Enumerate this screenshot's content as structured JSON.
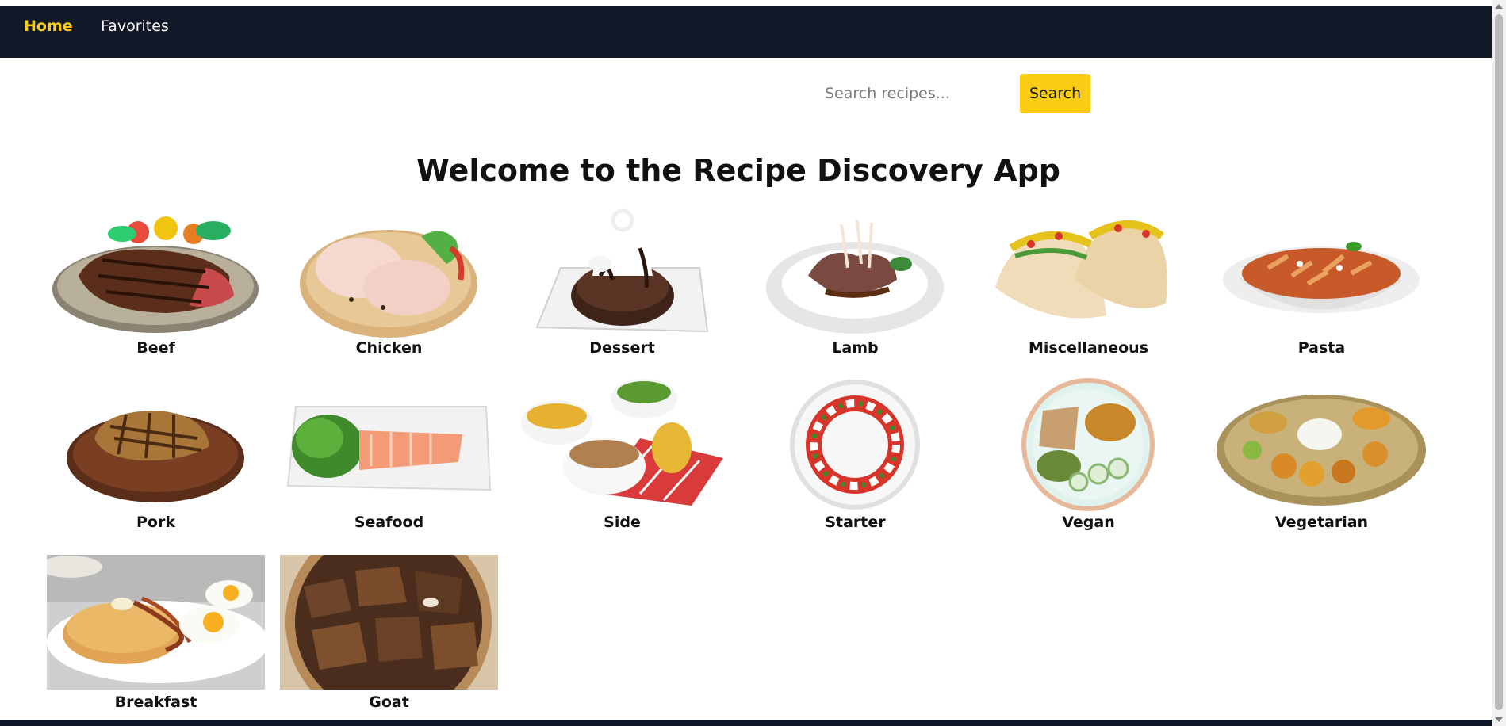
{
  "nav": {
    "items": [
      {
        "label": "Home",
        "active": true
      },
      {
        "label": "Favorites",
        "active": false
      }
    ],
    "active_color": "#facc15"
  },
  "search": {
    "placeholder": "Search recipes...",
    "value": "",
    "button_label": "Search",
    "button_color": "#facc15"
  },
  "page": {
    "title": "Welcome to the Recipe Discovery App"
  },
  "categories": [
    {
      "label": "Beef",
      "image": "grilled-steak-plate"
    },
    {
      "label": "Chicken",
      "image": "raw-chicken-legs-board"
    },
    {
      "label": "Dessert",
      "image": "chocolate-cake-dessert"
    },
    {
      "label": "Lamb",
      "image": "lamb-rack-plate"
    },
    {
      "label": "Miscellaneous",
      "image": "tacos"
    },
    {
      "label": "Pasta",
      "image": "penne-pasta-bowl"
    },
    {
      "label": "Pork",
      "image": "pork-chop-board"
    },
    {
      "label": "Seafood",
      "image": "salmon-platter"
    },
    {
      "label": "Side",
      "image": "side-dishes-bowls"
    },
    {
      "label": "Starter",
      "image": "caprese-salad-plate"
    },
    {
      "label": "Vegan",
      "image": "vegan-bowl"
    },
    {
      "label": "Vegetarian",
      "image": "vegetarian-thali"
    },
    {
      "label": "Breakfast",
      "image": "pancakes-eggs-breakfast"
    },
    {
      "label": "Goat",
      "image": "goat-meat-bowl"
    }
  ]
}
